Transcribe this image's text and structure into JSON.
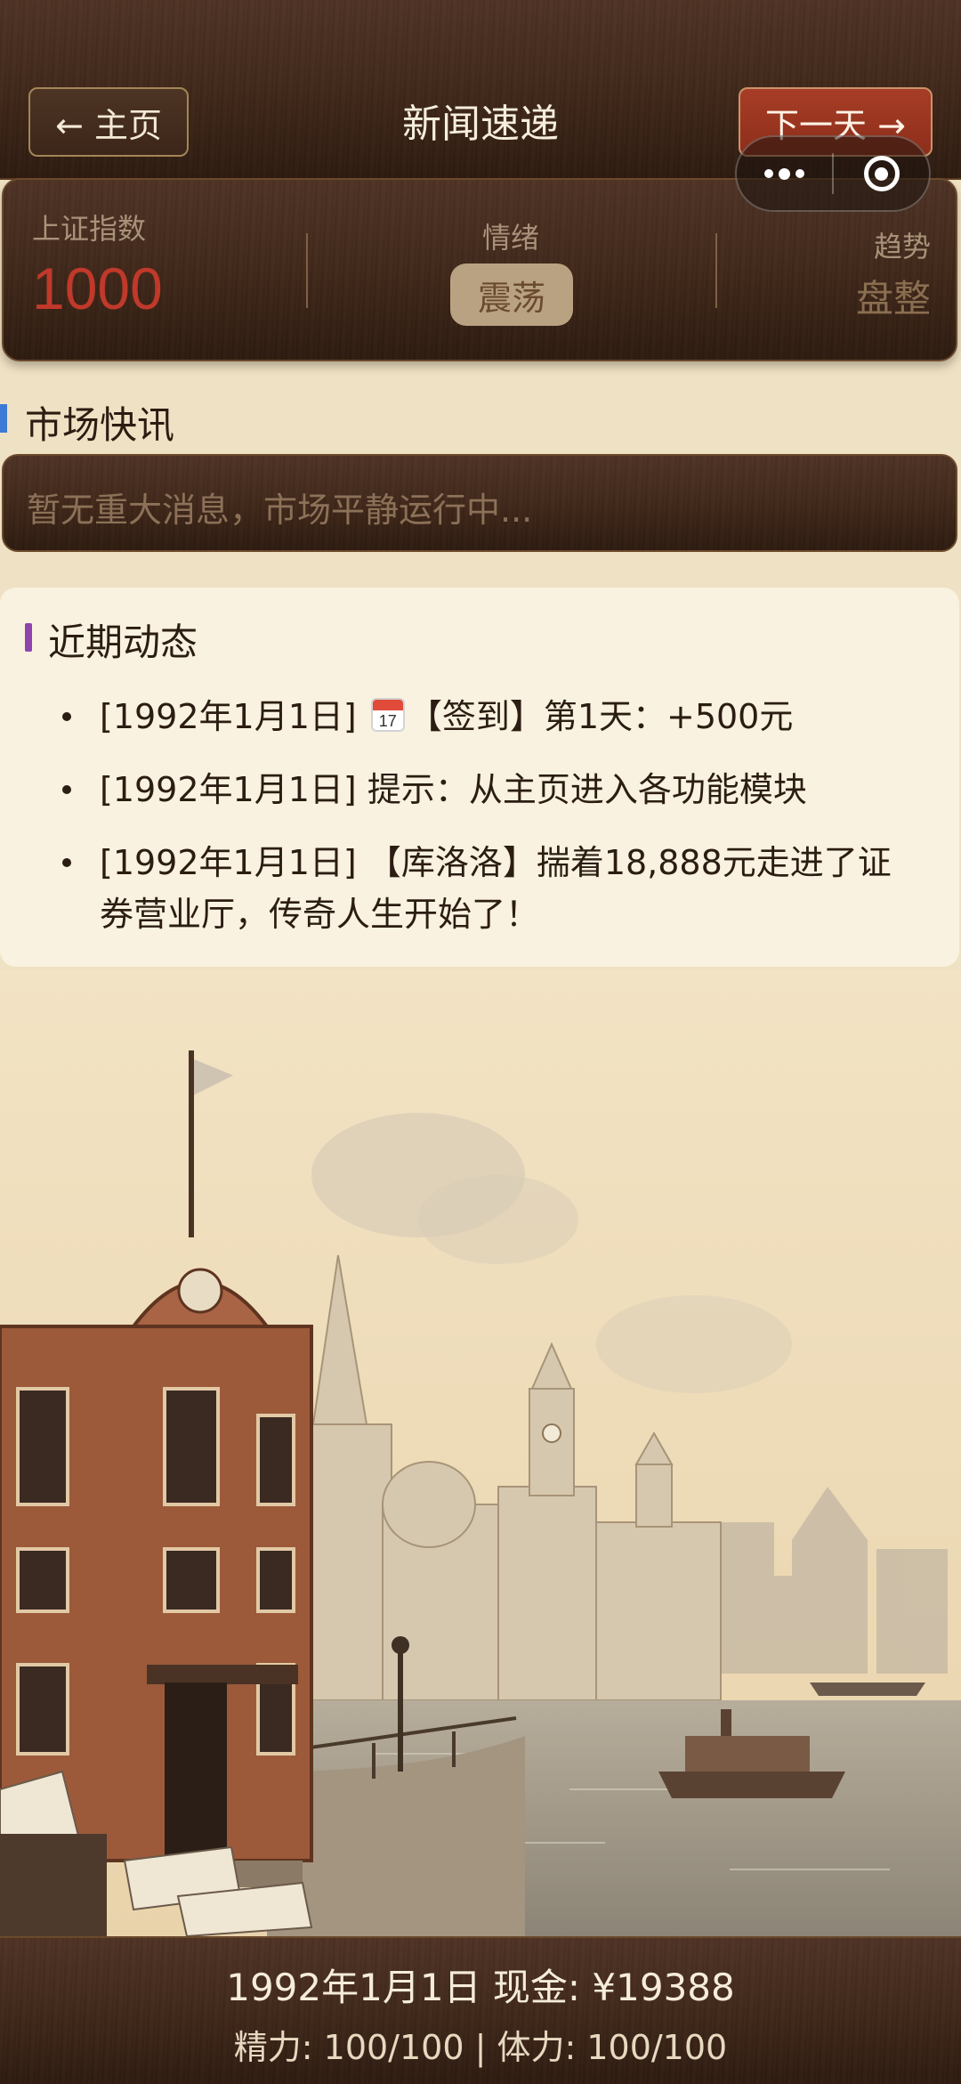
{
  "header": {
    "home_label": "← 主页",
    "title": "新闻速递",
    "next_label": "下一天 →"
  },
  "stats": {
    "index_label": "上证指数",
    "index_value": "1000",
    "mood_label": "情绪",
    "mood_value": "震荡",
    "trend_label": "趋势",
    "trend_value": "盘整"
  },
  "market_flash": {
    "title": "市场快讯",
    "text": "暂无重大消息，市场平静运行中..."
  },
  "recent": {
    "title": "近期动态",
    "items": [
      {
        "date": "[1992年1月1日]",
        "icon": "calendar-icon",
        "icon_text": "17",
        "text": "【签到】第1天：+500元"
      },
      {
        "date": "[1992年1月1日]",
        "text": "提示：从主页进入各功能模块"
      },
      {
        "date": "[1992年1月1日]",
        "text": "【库洛洛】揣着18,888元走进了证券营业厅，传奇人生开始了！"
      }
    ]
  },
  "footer": {
    "date_cash": "1992年1月1日  现金: ¥19388",
    "energy_stamina": "精力: 100/100 | 体力: 100/100"
  },
  "colors": {
    "accent_red": "#c0392b",
    "flash_bar": "#3d7ad6",
    "recent_bar": "#8e44ad",
    "wood_dark": "#3f2719",
    "parchment": "#efe1c3"
  }
}
